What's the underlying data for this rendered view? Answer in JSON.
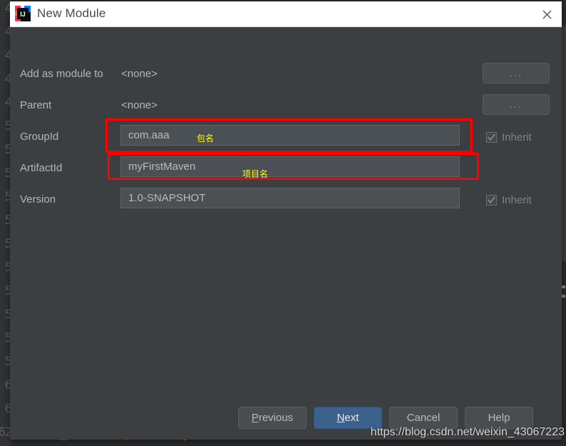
{
  "window": {
    "title": "New Module",
    "app_icon": "intellij-idea-icon",
    "close_icon": "close-icon"
  },
  "form": {
    "rows": [
      {
        "label": "Add as module to",
        "value": "<none>",
        "browse_label": "..."
      },
      {
        "label": "Parent",
        "value": "<none>",
        "browse_label": "..."
      },
      {
        "label": "GroupId",
        "value": "com.aaa",
        "inherit_label": "Inherit"
      },
      {
        "label": "ArtifactId",
        "value": "myFirstMaven"
      },
      {
        "label": "Version",
        "value": "1.0-SNAPSHOT",
        "inherit_label": "Inherit"
      }
    ]
  },
  "annotations": [
    {
      "text": "包名",
      "meaning": "package-name"
    },
    {
      "text": "项目名",
      "meaning": "project-name"
    }
  ],
  "buttons": {
    "previous": {
      "prefix": "",
      "mnemonic": "P",
      "suffix": "revious"
    },
    "next": {
      "prefix": "",
      "mnemonic": "N",
      "suffix": "ext"
    },
    "cancel": {
      "label": "Cancel"
    },
    "help": {
      "label": "Help"
    }
  },
  "background": {
    "code_line": "</dependency>",
    "gutter_numbers": [
      "4",
      "4",
      "4",
      "4",
      "4",
      "5",
      "5",
      "5",
      "5",
      "5",
      "5",
      "5",
      "5",
      "5",
      "5",
      "5",
      "6",
      "6",
      "62"
    ]
  },
  "watermark": "https://blog.csdn.net/weixin_43067223",
  "colors": {
    "dialog_bg": "#3c3f41",
    "titlebar_bg": "#ffffff",
    "field_bg": "#4b5054",
    "accent_blue": "#3c618c",
    "annotation_red": "#ff0000",
    "annotation_yellow": "#ffff00",
    "code_orange": "#cc8b42"
  }
}
